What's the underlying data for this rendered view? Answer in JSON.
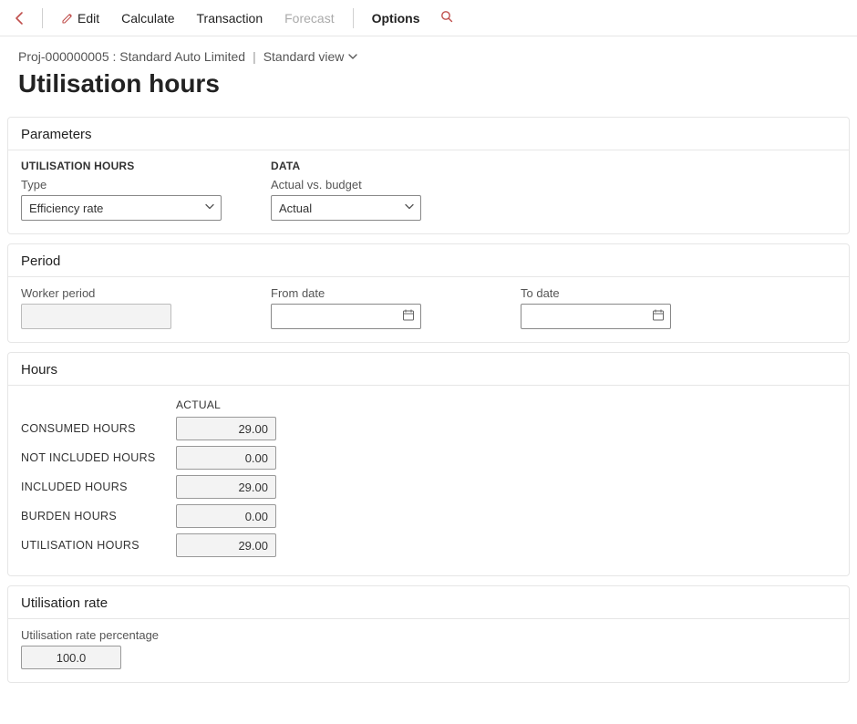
{
  "toolbar": {
    "edit_label": "Edit",
    "calculate_label": "Calculate",
    "transaction_label": "Transaction",
    "forecast_label": "Forecast",
    "options_label": "Options"
  },
  "breadcrumb": {
    "record": "Proj-000000005 : Standard Auto Limited",
    "view_label": "Standard view"
  },
  "page_title": "Utilisation hours",
  "parameters": {
    "section_title": "Parameters",
    "group_hours_label": "UTILISATION HOURS",
    "type_label": "Type",
    "type_value": "Efficiency rate",
    "group_data_label": "DATA",
    "avb_label": "Actual vs. budget",
    "avb_value": "Actual"
  },
  "period": {
    "section_title": "Period",
    "worker_label": "Worker period",
    "worker_value": "",
    "from_label": "From date",
    "from_value": "",
    "to_label": "To date",
    "to_value": ""
  },
  "hours": {
    "section_title": "Hours",
    "col_actual_label": "ACTUAL",
    "rows": {
      "consumed": {
        "label": "CONSUMED HOURS",
        "value": "29.00"
      },
      "not_included": {
        "label": "NOT INCLUDED HOURS",
        "value": "0.00"
      },
      "included": {
        "label": "INCLUDED HOURS",
        "value": "29.00"
      },
      "burden": {
        "label": "BURDEN HOURS",
        "value": "0.00"
      },
      "utilisation": {
        "label": "UTILISATION HOURS",
        "value": "29.00"
      }
    }
  },
  "rate": {
    "section_title": "Utilisation rate",
    "pct_label": "Utilisation rate percentage",
    "pct_value": "100.0"
  }
}
